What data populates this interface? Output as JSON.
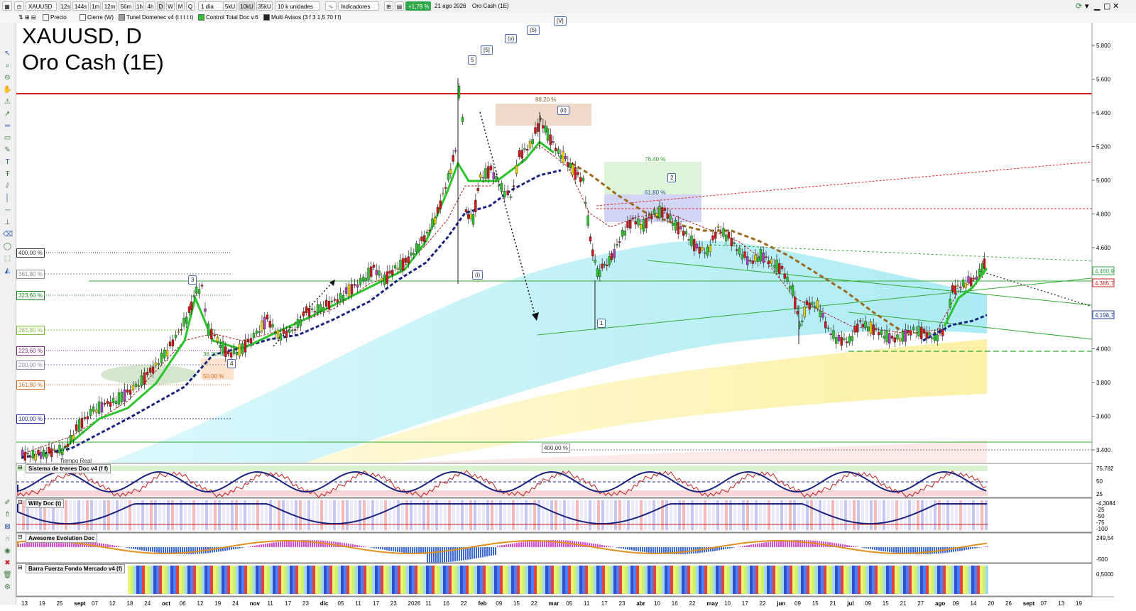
{
  "toolbar": {
    "symbol": "XAUUSD",
    "timeframes": [
      "12s",
      "144s",
      "1m",
      "12m",
      "56m",
      "1h",
      "4h",
      "D",
      "W",
      "M",
      "Q"
    ],
    "period": "1 día",
    "volume_buttons": [
      "5kU",
      "10kU",
      "35kU"
    ],
    "units": "10 k unidades",
    "indicators": "Indicadores",
    "change": "+1,78 %",
    "date": "21 ago 2026",
    "name": "Oro Cash (1E)"
  },
  "layers": [
    "Precio",
    "Cierre (W)",
    "Tunel Domenec v4 (t t t t t)",
    "Control Total Doc v.6",
    "Multi Avisos (3 f 3 1,5 70 f f)"
  ],
  "chart_title": [
    "XAUUSD, D",
    "Oro Cash (1E)"
  ],
  "price_axis": {
    "ticks": [
      "5.800",
      "5.600",
      "5.400",
      "5.200",
      "5.000",
      "4.800",
      "4.600",
      "4.400",
      "4.200",
      "4.000",
      "3.800",
      "3.600",
      "3.400"
    ],
    "badges": [
      {
        "text": "4.460,9",
        "color": "#2ea84a"
      },
      {
        "text": "4.385,7",
        "color": "#d02020"
      },
      {
        "text": "4.198,7",
        "color": "#1e3c9c"
      }
    ]
  },
  "fib_levels": [
    {
      "text": "400,00 %",
      "color": "#333333"
    },
    {
      "text": "361,80 %",
      "color": "#888888"
    },
    {
      "text": "323,60 %",
      "color": "#1f8a1f"
    },
    {
      "text": "261,80 %",
      "color": "#7fbf3f"
    },
    {
      "text": "223,60 %",
      "color": "#7a2a7a"
    },
    {
      "text": "200,00 %",
      "color": "#8a8ab0"
    },
    {
      "text": "161,80 %",
      "color": "#d06a20"
    },
    {
      "text": "100,00 %",
      "color": "#2a2aa0"
    }
  ],
  "chart_annotations": [
    "88,20 %",
    "76,40 %",
    "61,80 %",
    "38,20 %",
    "50,00 %",
    "400,00 %",
    "Tiempo Real"
  ],
  "wave_labels": [
    "5",
    "[5]",
    "(v)",
    "(5)",
    "[V]",
    "3",
    "4",
    "(i)",
    "(ii)",
    "2",
    "1"
  ],
  "panels": [
    {
      "title": "Sistema de trenes Doc v4 (f f)",
      "values": [
        "75,782",
        "50",
        "25"
      ]
    },
    {
      "title": "Willy Doc (t)",
      "values": [
        "-4,3084",
        "-25",
        "-50",
        "-75",
        "-100"
      ]
    },
    {
      "title": "Awesome Evolution Doc",
      "values": [
        "249,54",
        "-500"
      ]
    },
    {
      "title": "Barra Fuerza Fondo Mercado v4 (f)",
      "values": [
        "0,5000"
      ]
    }
  ],
  "x_axis": [
    "13",
    "19",
    "25",
    "sept",
    "07",
    "12",
    "18",
    "24",
    "oct",
    "06",
    "12",
    "19",
    "24",
    "nov",
    "11",
    "17",
    "23",
    "dic",
    "05",
    "11",
    "17",
    "23",
    "2026",
    "11",
    "16",
    "22",
    "feb",
    "09",
    "15",
    "22",
    "mar",
    "05",
    "11",
    "17",
    "23",
    "abr",
    "10",
    "16",
    "22",
    "may",
    "10",
    "17",
    "22",
    "jun",
    "09",
    "15",
    "21",
    "jul",
    "09",
    "15",
    "21",
    "27",
    "ago",
    "09",
    "14",
    "20",
    "26",
    "sept",
    "07",
    "13",
    "19"
  ],
  "colors": {
    "support_line": "#d41e1e",
    "bull": "#2cc42c",
    "bear": "#d01818",
    "trend_ma": "#1a237e",
    "cloud_blue": "#9ee8f2",
    "cloud_yellow": "#fbf1a0"
  }
}
